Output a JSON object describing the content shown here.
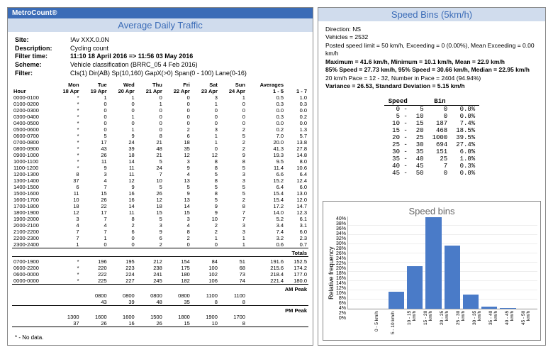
{
  "brand": "MetroCount®",
  "left_title": "Average Daily Traffic",
  "info": {
    "site_label": "Site:",
    "site": "!Av XXX.0.0N",
    "desc_label": "Description:",
    "desc": "Cycling count",
    "filter_time_label": "Filter time:",
    "filter_time": "11:10 18 April 2016 => 11:56 03 May 2016",
    "scheme_label": "Scheme:",
    "scheme": "Vehicle classification (BRRC_05 4 Feb 2016)",
    "filter_label": "Filter:",
    "filter": "Cls(1) Dir(AB) Sp(10,160) GapX(>0) Span(0 - 100) Lane(0-16)"
  },
  "day_headers1": [
    "Mon",
    "Tue",
    "Wed",
    "Thu",
    "Fri",
    "Sat",
    "Sun",
    "Averages",
    ""
  ],
  "day_headers2": [
    "18 Apr",
    "19 Apr",
    "20 Apr",
    "21 Apr",
    "22 Apr",
    "23 Apr",
    "24 Apr",
    "1 - 5",
    "1 - 7"
  ],
  "hour_label": "Hour",
  "rows": [
    {
      "h": "0000-0100",
      "v": [
        "*",
        "1",
        "1",
        "0",
        "0",
        "3",
        "1",
        "0.5",
        "1.0"
      ]
    },
    {
      "h": "0100-0200",
      "v": [
        "*",
        "0",
        "0",
        "1",
        "0",
        "1",
        "0",
        "0.3",
        "0.3"
      ]
    },
    {
      "h": "0200-0300",
      "v": [
        "*",
        "0",
        "0",
        "0",
        "0",
        "0",
        "0",
        "0.0",
        "0.0"
      ]
    },
    {
      "h": "0300-0400",
      "v": [
        "*",
        "0",
        "1",
        "0",
        "0",
        "0",
        "0",
        "0.3",
        "0.2"
      ]
    },
    {
      "h": "0400-0500",
      "v": [
        "*",
        "0",
        "0",
        "0",
        "0",
        "0",
        "0",
        "0.0",
        "0.0"
      ]
    },
    {
      "h": "0500-0600",
      "v": [
        "*",
        "0",
        "1",
        "0",
        "2",
        "3",
        "2",
        "0.2",
        "1.3"
      ]
    },
    {
      "h": "0600-0700",
      "v": [
        "*",
        "5",
        "9",
        "8",
        "6",
        "1",
        "5",
        "7.0",
        "5.7"
      ]
    },
    {
      "h": "0700-0800",
      "v": [
        "*",
        "17",
        "24",
        "21",
        "18",
        "1",
        "2",
        "20.0",
        "13.8"
      ]
    },
    {
      "h": "0800-0900",
      "v": [
        "*",
        "43",
        "39",
        "48",
        "35",
        "0",
        "2",
        "41.3",
        "27.8"
      ]
    },
    {
      "h": "0900-1000",
      "v": [
        "*",
        "26",
        "18",
        "21",
        "12",
        "12",
        "9",
        "19.3",
        "14.8"
      ]
    },
    {
      "h": "1000-1100",
      "v": [
        "*",
        "11",
        "14",
        "5",
        "3",
        "8",
        "8",
        "9.5",
        "8.0"
      ]
    },
    {
      "h": "1100-1200",
      "v": [
        "*",
        "9",
        "11",
        "24",
        "9",
        "8",
        "5",
        "11.4",
        "10.6"
      ]
    },
    {
      "h": "1200-1300",
      "v": [
        "8",
        "3",
        "11",
        "7",
        "4",
        "5",
        "3",
        "6.6",
        "6.4"
      ]
    },
    {
      "h": "1300-1400",
      "v": [
        "37",
        "4",
        "12",
        "10",
        "13",
        "8",
        "3",
        "15.2",
        "12.4"
      ]
    },
    {
      "h": "1400-1500",
      "v": [
        "6",
        "7",
        "9",
        "5",
        "5",
        "5",
        "5",
        "6.4",
        "6.0"
      ]
    },
    {
      "h": "1500-1600",
      "v": [
        "11",
        "15",
        "16",
        "26",
        "9",
        "8",
        "5",
        "15.4",
        "13.0"
      ]
    },
    {
      "h": "1600-1700",
      "v": [
        "10",
        "26",
        "16",
        "12",
        "13",
        "5",
        "2",
        "15.4",
        "12.0"
      ]
    },
    {
      "h": "1700-1800",
      "v": [
        "18",
        "22",
        "14",
        "18",
        "14",
        "9",
        "8",
        "17.2",
        "14.7"
      ]
    },
    {
      "h": "1800-1900",
      "v": [
        "12",
        "17",
        "11",
        "15",
        "15",
        "9",
        "7",
        "14.0",
        "12.3"
      ]
    },
    {
      "h": "1900-2000",
      "v": [
        "3",
        "7",
        "8",
        "5",
        "3",
        "10",
        "7",
        "5.2",
        "6.1"
      ]
    },
    {
      "h": "2000-2100",
      "v": [
        "4",
        "4",
        "2",
        "3",
        "4",
        "2",
        "3",
        "3.4",
        "3.1"
      ]
    },
    {
      "h": "2100-2200",
      "v": [
        "7",
        "7",
        "6",
        "9",
        "8",
        "2",
        "3",
        "7.4",
        "6.0"
      ]
    },
    {
      "h": "2200-2300",
      "v": [
        "7",
        "1",
        "0",
        "6",
        "2",
        "1",
        "1",
        "3.2",
        "2.3"
      ]
    },
    {
      "h": "2300-2400",
      "v": [
        "1",
        "0",
        "0",
        "2",
        "0",
        "0",
        "1",
        "0.6",
        "0.7"
      ]
    }
  ],
  "totals_label": "Totals",
  "totals": [
    {
      "h": "0700-1900",
      "v": [
        "*",
        "196",
        "195",
        "212",
        "154",
        "84",
        "51",
        "191.6",
        "152.5"
      ]
    },
    {
      "h": "0600-2200",
      "v": [
        "*",
        "220",
        "223",
        "238",
        "175",
        "100",
        "68",
        "215.6",
        "174.2"
      ]
    },
    {
      "h": "0600-0000",
      "v": [
        "*",
        "222",
        "224",
        "241",
        "180",
        "102",
        "73",
        "218.4",
        "177.0"
      ]
    },
    {
      "h": "0000-0000",
      "v": [
        "*",
        "225",
        "227",
        "245",
        "182",
        "106",
        "74",
        "221.4",
        "180.0"
      ]
    }
  ],
  "am_label": "AM Peak",
  "am": [
    {
      "h": "",
      "v": [
        "",
        "0800",
        "0800",
        "0800",
        "0800",
        "1100",
        "1100",
        ""
      ]
    },
    {
      "h": "",
      "v": [
        "",
        "43",
        "39",
        "48",
        "35",
        "8",
        "8",
        ""
      ]
    }
  ],
  "pm_label": "PM Peak",
  "pm": [
    {
      "h": "",
      "v": [
        "1300",
        "1600",
        "1600",
        "1500",
        "1800",
        "1900",
        "1700",
        ""
      ]
    },
    {
      "h": "",
      "v": [
        "37",
        "26",
        "16",
        "26",
        "15",
        "10",
        "8",
        ""
      ]
    }
  ],
  "footnote": "* - No data.",
  "right_title": "Speed Bins (5km/h)",
  "speed_info": {
    "direction": "Direction: NS",
    "vehicles": "Vehicles = 2532",
    "limit": "Posted speed limit = 50 km/h, Exceeding = 0 (0.00%), Mean Exceeding = 0.00 km/h",
    "maxmin": "Maximum = 41.6 km/h, Minimum = 10.1 km/h, Mean = 22.9 km/h",
    "pct85": "85% Speed = 27.73 km/h, 95% Speed = 30.66 km/h, Median = 22.95 km/h",
    "pace": "20 km/h Pace = 12 - 32, Number in Pace = 2404 (94.94%)",
    "variance": "Variance = 26.53, Standard Deviation = 5.15 km/h"
  },
  "bins_head": [
    "Speed",
    "",
    "Bin",
    ""
  ],
  "bins": [
    [
      "0 -",
      "5",
      "0",
      "0.0%"
    ],
    [
      "5 -",
      "10",
      "0",
      "0.0%"
    ],
    [
      "10 -",
      "15",
      "187",
      "7.4%"
    ],
    [
      "15 -",
      "20",
      "468",
      "18.5%"
    ],
    [
      "20 -",
      "25",
      "1000",
      "39.5%"
    ],
    [
      "25 -",
      "30",
      "694",
      "27.4%"
    ],
    [
      "30 -",
      "35",
      "151",
      "6.0%"
    ],
    [
      "35 -",
      "40",
      "25",
      "1.0%"
    ],
    [
      "40 -",
      "45",
      "7",
      "0.3%"
    ],
    [
      "45 -",
      "50",
      "0",
      "0.0%"
    ]
  ],
  "chart_title": "Speed bins",
  "chart_ylabel": "Relative frequency",
  "chart_data": {
    "type": "bar",
    "categories": [
      "0 - 5 km/h",
      "5 - 10 km/h",
      "10 - 15 km/h",
      "15 - 20 km/h",
      "20 - 25 km/h",
      "25 - 30 km/h",
      "30 - 35 km/h",
      "35 - 40 km/h",
      "40 - 45 km/h",
      "45 - 50 km/h"
    ],
    "values": [
      0,
      0,
      7.4,
      18.5,
      39.5,
      27.4,
      6.0,
      1.0,
      0.3,
      0.0
    ],
    "ylim": [
      0,
      40
    ],
    "yticks": [
      40,
      38,
      36,
      34,
      32,
      30,
      28,
      26,
      24,
      22,
      20,
      18,
      16,
      14,
      12,
      10,
      8,
      6,
      4,
      2,
      0
    ],
    "ylabel": "Relative frequency",
    "title": "Speed bins"
  }
}
